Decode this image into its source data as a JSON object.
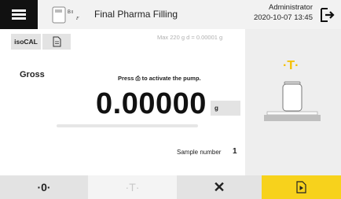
{
  "header": {
    "title": "Final Pharma Filling",
    "user": "Administrator",
    "datetime": "2020-10-07 13:45"
  },
  "toolbar": {
    "isocal_label": "isoCAL",
    "range_text": "Max 220 g    d = 0.00001 g"
  },
  "weighing": {
    "mode": "Gross",
    "prompt": "Press ⎙ to activate the pump.",
    "value": "0.00000",
    "unit": "g",
    "sample_label": "Sample number",
    "sample_number": "1"
  },
  "scale": {
    "marker": "·T·"
  },
  "bottom": {
    "zero_label": "·0·",
    "tare_label": "·T·",
    "clear_label": "✕"
  },
  "colors": {
    "accent": "#f7d21c",
    "topbar": "#f2f2f2",
    "button": "#e3e3e3"
  },
  "icons": [
    "menu-icon",
    "task-icon",
    "logout-icon",
    "document-icon",
    "start-pump-icon"
  ]
}
